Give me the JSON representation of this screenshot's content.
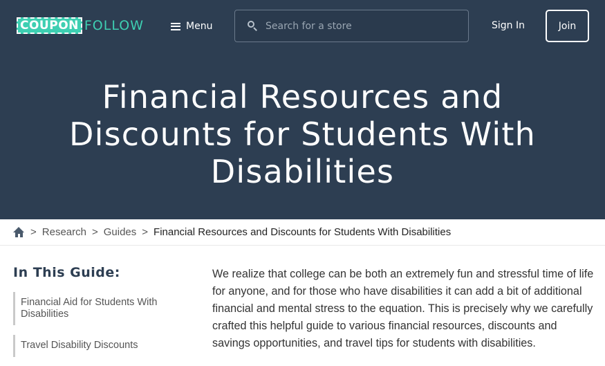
{
  "header": {
    "logo_coupon": "COUPON",
    "logo_follow": "FOLLOW",
    "menu_label": "Menu",
    "search_placeholder": "Search for a store",
    "signin_label": "Sign In",
    "join_label": "Join",
    "title": "Financial Resources and Discounts for Students With Disabilities"
  },
  "breadcrumb": {
    "separator": ">",
    "items": [
      "Research",
      "Guides"
    ],
    "current": "Financial Resources and Discounts for Students With Disabilities"
  },
  "guide": {
    "title": "In This Guide:",
    "items": [
      {
        "label": "Financial Aid for Students With Disabilities"
      },
      {
        "label": "Travel Disability Discounts"
      }
    ]
  },
  "article": {
    "intro": "We realize that college can be both an extremely fun and stressful time of life for anyone, and for those who have disabilities it can add a bit of additional financial and mental stress to the equation. This is precisely why we carefully crafted this helpful guide to various financial resources, discounts and savings opportunities, and travel tips for students with disabilities."
  },
  "colors": {
    "header_bg": "#2d3e52",
    "brand_accent": "#3ecfb2"
  },
  "icons": [
    "hamburger-icon",
    "search-icon",
    "home-icon"
  ]
}
